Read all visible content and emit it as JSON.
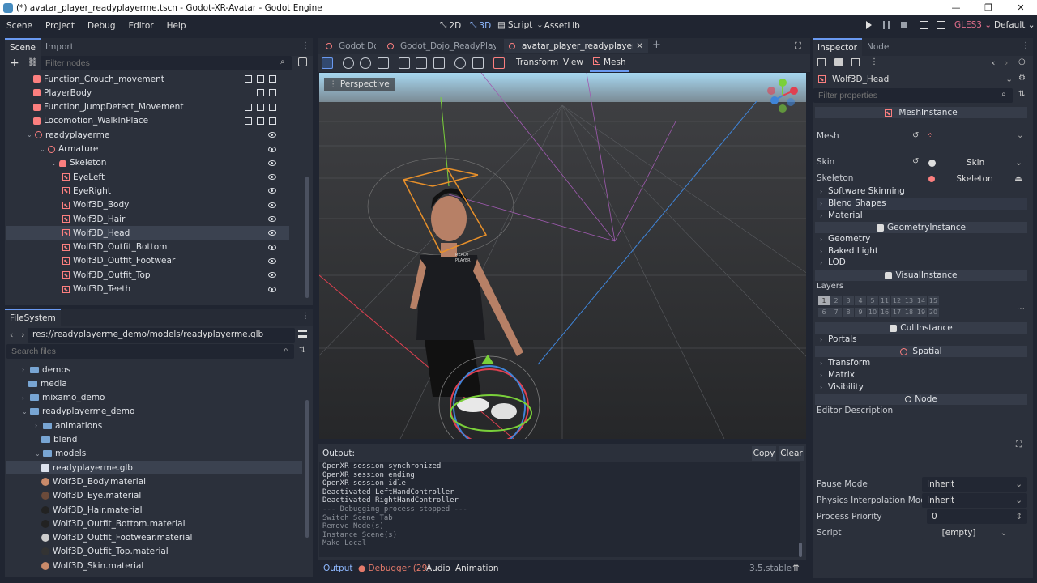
{
  "window": {
    "title": "(*) avatar_player_readyplayerme.tscn - Godot-XR-Avatar - Godot Engine",
    "min": "—",
    "max": "❐",
    "close": "✕"
  },
  "menu": [
    "Scene",
    "Project",
    "Debug",
    "Editor",
    "Help"
  ],
  "workspaces": [
    {
      "label": "2D",
      "icon": "⤡"
    },
    {
      "label": "3D",
      "icon": "⤡",
      "active": true
    },
    {
      "label": "Script",
      "icon": "▤"
    },
    {
      "label": "AssetLib",
      "icon": "⤓"
    }
  ],
  "run": {
    "renderer": "GLES3",
    "layout": "Default"
  },
  "scene_dock": {
    "tabs": [
      "Scene",
      "Import"
    ],
    "filter_placeholder": "Filter nodes",
    "nodes": [
      {
        "label": "Function_Crouch_movement",
        "icon": "node3",
        "indent": 34,
        "rt": "3"
      },
      {
        "label": "PlayerBody",
        "icon": "node3",
        "indent": 34,
        "rt": "2"
      },
      {
        "label": "Function_JumpDetect_Movement",
        "icon": "node3",
        "indent": 34,
        "rt": "3"
      },
      {
        "label": "Locomotion_WalkInPlace",
        "icon": "node3",
        "indent": 34,
        "rt": "3"
      },
      {
        "label": "readyplayerme",
        "icon": "spatial",
        "indent": 26,
        "rt": "eye",
        "arrow": "⌄"
      },
      {
        "label": "Armature",
        "icon": "spatial",
        "indent": 42,
        "rt": "eye",
        "arrow": "⌄"
      },
      {
        "label": "Skeleton",
        "icon": "skel",
        "indent": 56,
        "rt": "eye",
        "arrow": "⌄"
      },
      {
        "label": "EyeLeft",
        "icon": "mesh",
        "indent": 70,
        "rt": "eye"
      },
      {
        "label": "EyeRight",
        "icon": "mesh",
        "indent": 70,
        "rt": "eye"
      },
      {
        "label": "Wolf3D_Body",
        "icon": "mesh",
        "indent": 70,
        "rt": "eye"
      },
      {
        "label": "Wolf3D_Hair",
        "icon": "mesh",
        "indent": 70,
        "rt": "eye"
      },
      {
        "label": "Wolf3D_Head",
        "icon": "mesh",
        "indent": 70,
        "rt": "eye",
        "sel": true
      },
      {
        "label": "Wolf3D_Outfit_Bottom",
        "icon": "mesh",
        "indent": 70,
        "rt": "eye"
      },
      {
        "label": "Wolf3D_Outfit_Footwear",
        "icon": "mesh",
        "indent": 70,
        "rt": "eye"
      },
      {
        "label": "Wolf3D_Outfit_Top",
        "icon": "mesh",
        "indent": 70,
        "rt": "eye"
      },
      {
        "label": "Wolf3D_Teeth",
        "icon": "mesh",
        "indent": 70,
        "rt": "eye"
      }
    ]
  },
  "filesystem": {
    "title": "FileSystem",
    "path": "res://readyplayerme_demo/models/readyplayerme.glb",
    "search_placeholder": "Search files",
    "items": [
      {
        "label": "demos",
        "icon": "folder",
        "indent": 20,
        "arrow": "›"
      },
      {
        "label": "media",
        "icon": "folder",
        "indent": 28
      },
      {
        "label": "mixamo_demo",
        "icon": "folder",
        "indent": 20,
        "arrow": "›"
      },
      {
        "label": "readyplayerme_demo",
        "icon": "folder",
        "indent": 20,
        "arrow": "⌄"
      },
      {
        "label": "animations",
        "icon": "folder",
        "indent": 36,
        "arrow": "›"
      },
      {
        "label": "blend",
        "icon": "folder",
        "indent": 44
      },
      {
        "label": "models",
        "icon": "folder",
        "indent": 36,
        "arrow": "⌄"
      },
      {
        "label": "readyplayerme.glb",
        "icon": "glb",
        "indent": 44,
        "sel": true
      },
      {
        "label": "Wolf3D_Body.material",
        "icon": "mat",
        "indent": 44,
        "color": "#c98a6a"
      },
      {
        "label": "Wolf3D_Eye.material",
        "icon": "mat",
        "indent": 44,
        "color": "#6b4a3a"
      },
      {
        "label": "Wolf3D_Hair.material",
        "icon": "mat",
        "indent": 44,
        "color": "#222"
      },
      {
        "label": "Wolf3D_Outfit_Bottom.material",
        "icon": "mat",
        "indent": 44,
        "color": "#222"
      },
      {
        "label": "Wolf3D_Outfit_Footwear.material",
        "icon": "mat",
        "indent": 44,
        "color": "#ccc"
      },
      {
        "label": "Wolf3D_Outfit_Top.material",
        "icon": "mat",
        "indent": 44,
        "color": "#333"
      },
      {
        "label": "Wolf3D_Skin.material",
        "icon": "mat",
        "indent": 44,
        "color": "#c98a6a"
      }
    ]
  },
  "editor_tabs": [
    {
      "label": "Godot Dojo"
    },
    {
      "label": "Godot_Dojo_ReadyPlayerMe"
    },
    {
      "label": "avatar_player_readyplayerme(*)",
      "sel": true
    }
  ],
  "viewport_toolbar": {
    "transform": "Transform",
    "view": "View",
    "mesh": "Mesh"
  },
  "viewport": {
    "perspective": "Perspective",
    "shirt_text": "READY\nPLAYER\nME"
  },
  "output": {
    "title": "Output:",
    "copy": "Copy",
    "clear": "Clear",
    "lines": [
      {
        "t": "OpenXR session synchronized",
        "dim": false
      },
      {
        "t": "OpenXR session ending",
        "dim": false
      },
      {
        "t": "OpenXR session idle",
        "dim": false
      },
      {
        "t": "Deactivated LeftHandController",
        "dim": false
      },
      {
        "t": "Deactivated RightHandController",
        "dim": false
      },
      {
        "t": "--- Debugging process stopped ---",
        "dim": true
      },
      {
        "t": "Switch Scene Tab",
        "dim": true
      },
      {
        "t": "Remove Node(s)",
        "dim": true
      },
      {
        "t": "Instance Scene(s)",
        "dim": true
      },
      {
        "t": "Make Local",
        "dim": true
      }
    ]
  },
  "bottom": {
    "output": "Output",
    "debugger": "Debugger (29)",
    "audio": "Audio",
    "animation": "Animation",
    "version": "3.5.stable"
  },
  "inspector": {
    "tabs": [
      "Inspector",
      "Node"
    ],
    "object": "Wolf3D_Head",
    "filter_placeholder": "Filter properties",
    "mesh_instance": "MeshInstance",
    "mesh_label": "Mesh",
    "skin_label": "Skin",
    "skin_value": "Skin",
    "skeleton_label": "Skeleton",
    "skeleton_value": "Skeleton",
    "sub1": [
      "Software Skinning",
      "Blend Shapes",
      "Material"
    ],
    "geometry_instance": "GeometryInstance",
    "sub2": [
      "Geometry",
      "Baked Light",
      "LOD"
    ],
    "visual_instance": "VisualInstance",
    "layers_label": "Layers",
    "layers_row1": [
      "1",
      "2",
      "3",
      "4",
      "5",
      "11",
      "12",
      "13",
      "14",
      "15"
    ],
    "layers_row2": [
      "6",
      "7",
      "8",
      "9",
      "10",
      "16",
      "17",
      "18",
      "19",
      "20"
    ],
    "cull_instance": "CullInstance",
    "portals": "Portals",
    "spatial": "Spatial",
    "sub3": [
      "Transform",
      "Matrix",
      "Visibility"
    ],
    "node": "Node",
    "editor_description": "Editor Description",
    "pause_mode_label": "Pause Mode",
    "pause_mode": "Inherit",
    "physics_label": "Physics Interpolation Mode",
    "physics": "Inherit",
    "priority_label": "Process Priority",
    "priority": "0",
    "script_label": "Script",
    "script": "[empty]"
  },
  "colors": {
    "accent": "#6a99f0",
    "node_icon": "#fc7f7f",
    "bg": "#202531",
    "panel": "#2b303b"
  }
}
